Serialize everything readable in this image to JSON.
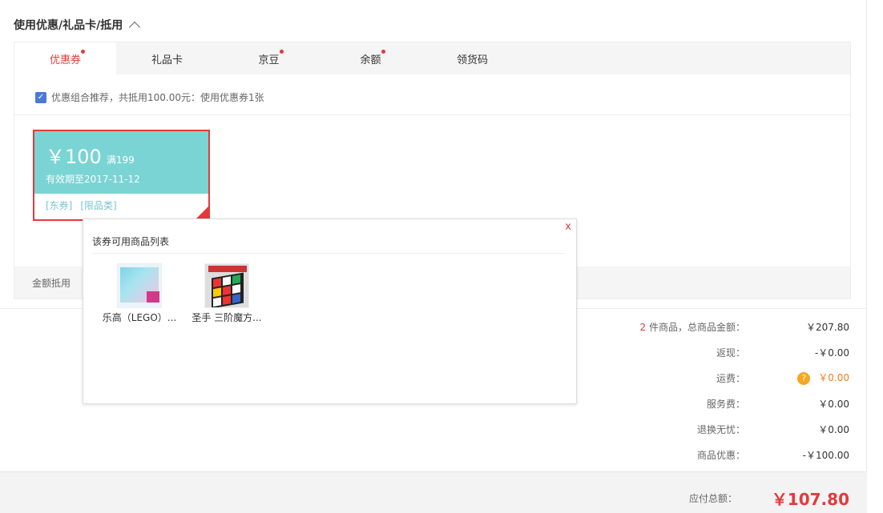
{
  "section": {
    "title": "使用优惠/礼品卡/抵用"
  },
  "tabs": [
    {
      "label": "优惠券",
      "dot": true
    },
    {
      "label": "礼品卡",
      "dot": false
    },
    {
      "label": "京豆",
      "dot": true
    },
    {
      "label": "余额",
      "dot": true
    },
    {
      "label": "领货码",
      "dot": false
    }
  ],
  "combo": {
    "text": "优惠组合推荐，共抵用100.00元：使用优惠券1张"
  },
  "coupon": {
    "amount": "￥100",
    "condition": "满199",
    "expiry": "有效期至2017-11-12",
    "tags": [
      "[东券]",
      "[限品类]"
    ]
  },
  "amount_strip": {
    "label": "金额抵用"
  },
  "popup": {
    "close": "x",
    "title": "该券可用商品列表",
    "products": [
      {
        "name": "乐高（LEGO）..."
      },
      {
        "name": "圣手 三阶魔方..."
      }
    ]
  },
  "summary": {
    "count": "2",
    "rows": [
      {
        "label": " 件商品，总商品金额：",
        "value": "￥207.80"
      },
      {
        "label": "返现：",
        "value": "-￥0.00"
      },
      {
        "label": "运费：",
        "value": "￥0.00"
      },
      {
        "label": "服务费：",
        "value": "￥0.00"
      },
      {
        "label": "退换无忧：",
        "value": "￥0.00"
      },
      {
        "label": "商品优惠：",
        "value": "-￥100.00"
      }
    ],
    "help_icon": "?"
  },
  "total": {
    "label": "应付总额：",
    "value": "￥107.80"
  },
  "colors": {
    "accent": "#e4393c",
    "coupon": "#7bd4d4",
    "warn": "#f5a623"
  }
}
